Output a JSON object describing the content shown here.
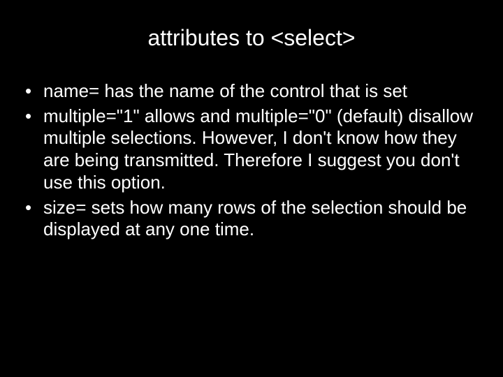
{
  "slide": {
    "title": "attributes to <select>",
    "bullets": [
      "name= has the name of the control that is set",
      "multiple=\"1\" allows and multiple=\"0\" (default) disallow multiple selections. However, I don't know how they are being transmitted. Therefore I suggest you don't use this option.",
      "size= sets how many rows of the selection should be displayed at any one time."
    ]
  }
}
